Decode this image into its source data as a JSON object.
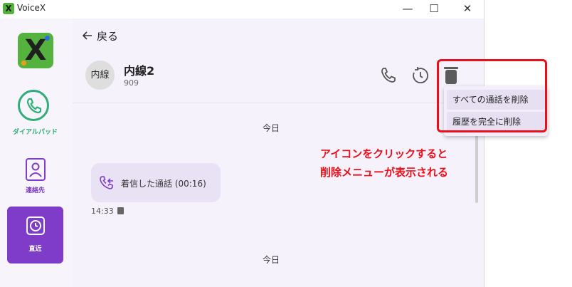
{
  "window": {
    "title": "VoiceX",
    "minimize": "—",
    "maximize": "☐",
    "close": "✕"
  },
  "sidebar": {
    "logo_letter": "X",
    "items": [
      {
        "label": "ダイアルパッド"
      },
      {
        "label": "連絡先"
      },
      {
        "label": "直近"
      }
    ]
  },
  "main": {
    "back_label": "戻る",
    "contact": {
      "avatar_text": "内線",
      "name": "内線2",
      "number": "909"
    },
    "days": [
      "今日",
      "今日"
    ],
    "call": {
      "text": "着信した通話 (00:16)",
      "time": "14:33"
    }
  },
  "menu": {
    "items": [
      "すべての通話を削除",
      "履歴を完全に削除"
    ]
  },
  "annotation": {
    "line1": "アイコンをクリックすると",
    "line2": "削除メニューが表示される"
  },
  "colors": {
    "accent": "#7e3cc8",
    "green": "#2fae79",
    "annotation_red": "#e8101a"
  }
}
